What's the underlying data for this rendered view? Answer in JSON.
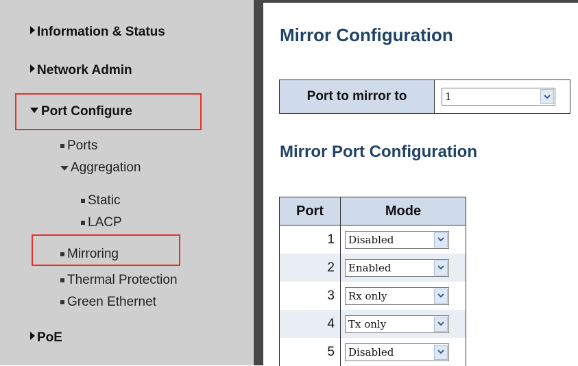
{
  "sidebar": {
    "items": [
      {
        "label": "Information & Status",
        "type": "section",
        "expanded": false
      },
      {
        "label": "Network Admin",
        "type": "section",
        "expanded": false
      },
      {
        "label": "Port Configure",
        "type": "section",
        "expanded": true,
        "highlighted": true
      },
      {
        "label": "Ports",
        "type": "item"
      },
      {
        "label": "Aggregation",
        "type": "subsection",
        "expanded": true
      },
      {
        "label": "Static",
        "type": "subitem"
      },
      {
        "label": "LACP",
        "type": "subitem"
      },
      {
        "label": "Mirroring",
        "type": "item",
        "highlighted": true
      },
      {
        "label": "Thermal Protection",
        "type": "item"
      },
      {
        "label": "Green Ethernet",
        "type": "item"
      },
      {
        "label": "PoE",
        "type": "section",
        "expanded": false
      }
    ]
  },
  "main": {
    "title": "Mirror Configuration",
    "mirror_to": {
      "label": "Port to mirror to",
      "value": "1"
    },
    "subtitle": "Mirror Port Configuration",
    "table": {
      "headers": [
        "Port",
        "Mode"
      ],
      "rows": [
        {
          "port": "1",
          "mode": "Disabled"
        },
        {
          "port": "2",
          "mode": "Enabled"
        },
        {
          "port": "3",
          "mode": "Rx only"
        },
        {
          "port": "4",
          "mode": "Tx only"
        },
        {
          "port": "5",
          "mode": "Disabled"
        }
      ]
    }
  },
  "colors": {
    "sidebar_bg": "#cfcfcf",
    "divider": "#474747",
    "heading": "#1f4266",
    "header_cell": "#cfdaea",
    "highlight_box": "#e8302a"
  }
}
